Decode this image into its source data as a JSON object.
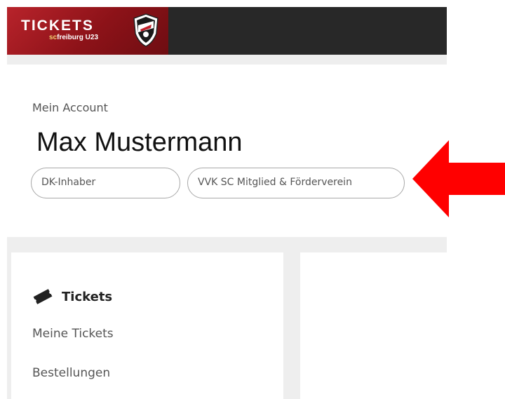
{
  "header": {
    "logo_title": "TICKETS",
    "logo_sub_prefix": "sc",
    "logo_sub": "freiburg U23",
    "logo_icon": "club-crest-icon"
  },
  "account": {
    "label": "Mein Account",
    "name": "Max Mustermann",
    "badges": [
      "DK-Inhaber",
      "VVK SC Mitglied & Förderverein"
    ]
  },
  "sidebar": {
    "section_title": "Tickets",
    "section_icon": "ticket-icon",
    "links": [
      "Meine Tickets",
      "Bestellungen"
    ]
  },
  "annotation": {
    "arrow_color": "#ff0000",
    "arrow_direction": "left"
  },
  "colors": {
    "topbar": "#282828",
    "logo_red": "#b8232b",
    "panel_gray": "#eeeeee"
  }
}
